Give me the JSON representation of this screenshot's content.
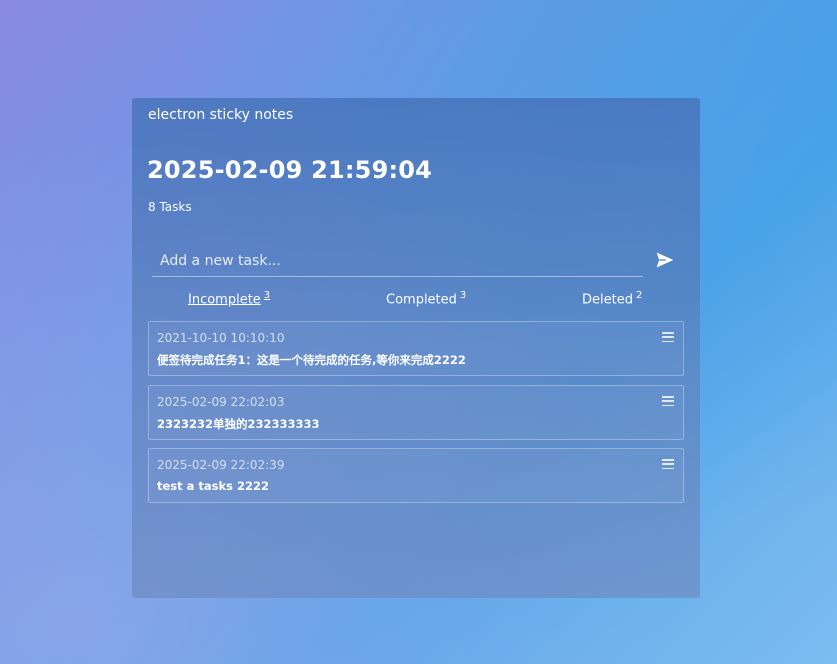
{
  "app": {
    "title": "electron sticky notes"
  },
  "header": {
    "datetime": "2025-02-09 21:59:04",
    "task_count": "8 Tasks"
  },
  "new_task": {
    "placeholder": "Add a new task...",
    "value": "",
    "send_icon": "send-icon"
  },
  "tabs": [
    {
      "label": "Incomplete",
      "count": "3",
      "active": true
    },
    {
      "label": "Completed",
      "count": "3",
      "active": false
    },
    {
      "label": "Deleted",
      "count": "2",
      "active": false
    }
  ],
  "tasks": [
    {
      "time": "2021-10-10 10:10:10",
      "text": "便签待完成任务1：这是一个待完成的任务,等你来完成2222",
      "icon": "menu-icon"
    },
    {
      "time": "2025-02-09 22:02:03",
      "text": "2323232单独的232333333",
      "icon": "menu-icon"
    },
    {
      "time": "2025-02-09 22:02:39",
      "text": "test a tasks 2222",
      "icon": "menu-icon"
    }
  ]
}
